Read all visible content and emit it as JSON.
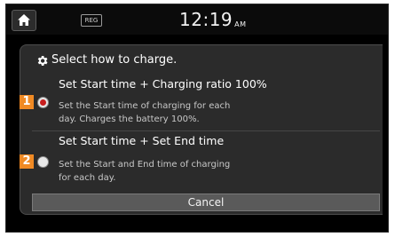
{
  "status_bar": {
    "home_icon": "home-icon",
    "reg_label": "REG",
    "time": "12:19",
    "ampm": "AM"
  },
  "dialog": {
    "header_icon": "gear-icon",
    "header": "Select how to charge.",
    "options": [
      {
        "number": "1",
        "title": "Set Start time + Charging ratio 100%",
        "description_line1": "Set the Start time of charging for each",
        "description_line2": "day. Charges the battery 100%.",
        "selected": true
      },
      {
        "number": "2",
        "title": "Set Start time + Set End time",
        "description_line1": "Set the Start and End time of charging",
        "description_line2": "for each day.",
        "selected": false
      }
    ],
    "cancel_label": "Cancel"
  },
  "colors": {
    "accent_badge": "#f08a24",
    "selected_radio": "#c81e1e",
    "background": "#000000",
    "panel": "#2b2b2b"
  }
}
